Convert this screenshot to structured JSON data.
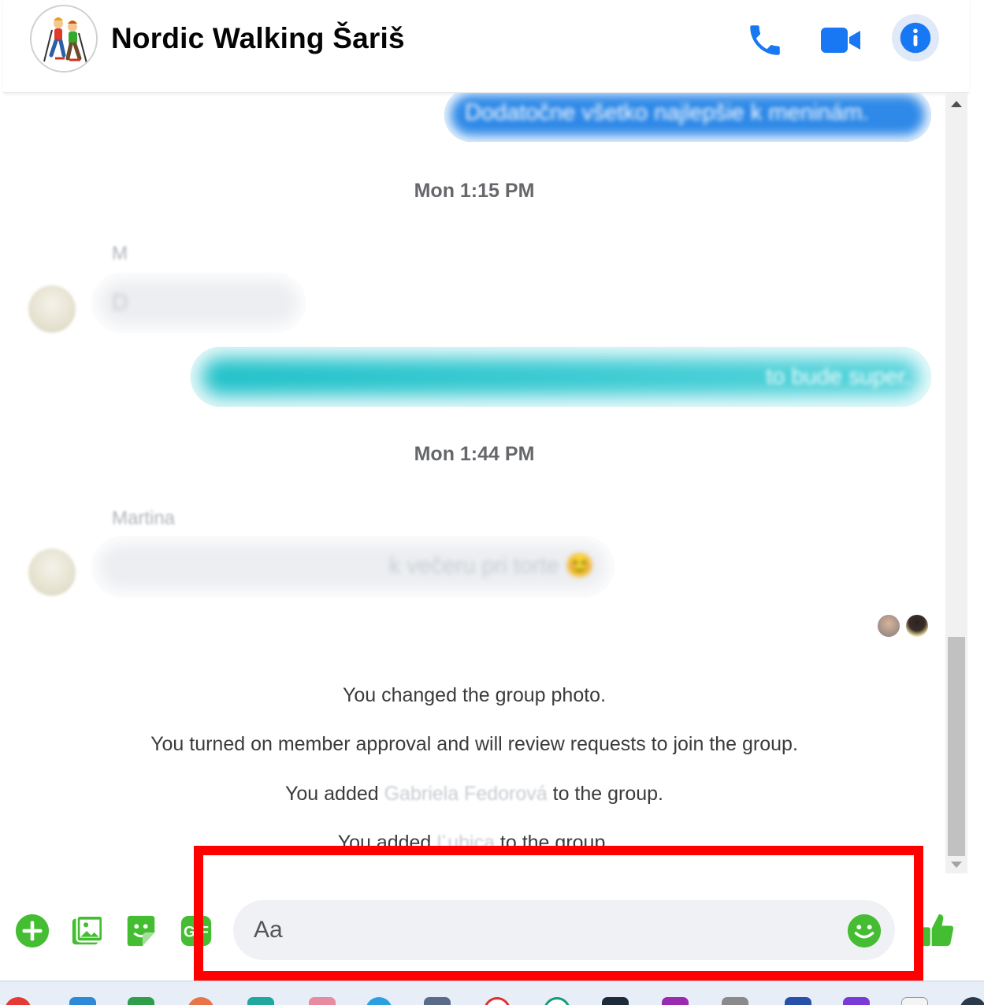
{
  "header": {
    "title": "Nordic Walking Šariš",
    "avatar_icon": "group-photo-nordic-walkers",
    "actions": [
      {
        "name": "phone-call-icon"
      },
      {
        "name": "video-call-icon"
      },
      {
        "name": "info-icon"
      }
    ],
    "accent_color": "#1877f2"
  },
  "conversation": {
    "messages": [
      {
        "type": "outgoing",
        "text": "Dodatočne všetko najlepšie k meninám.",
        "color": "#2e89e8"
      },
      {
        "type": "timestamp",
        "text": "Mon 1:15 PM"
      },
      {
        "type": "incoming",
        "sender": "M",
        "text": "D"
      },
      {
        "type": "outgoing",
        "text": "to bude super.",
        "color": "#1fc1c9"
      },
      {
        "type": "timestamp",
        "text": "Mon 1:44 PM"
      },
      {
        "type": "incoming",
        "sender": "Martina",
        "text": "k večeru pri torte 😊"
      }
    ],
    "system_messages": [
      {
        "text": "You changed the group photo."
      },
      {
        "text": "You turned on member approval and will review requests to join the group."
      },
      {
        "prefix": "You added ",
        "name": "Gabriela Fedorová",
        "suffix": " to the group."
      },
      {
        "prefix": "You added ",
        "name": "Ľubica",
        "suffix": " to the group."
      }
    ]
  },
  "composer": {
    "placeholder": "Aa",
    "buttons": [
      "plus-icon",
      "image-icon",
      "sticker-icon",
      "gif-icon",
      "emoji-icon",
      "like-icon"
    ],
    "icon_color": "#44bd32"
  },
  "annotation": {
    "highlight_color": "#ff0000"
  }
}
